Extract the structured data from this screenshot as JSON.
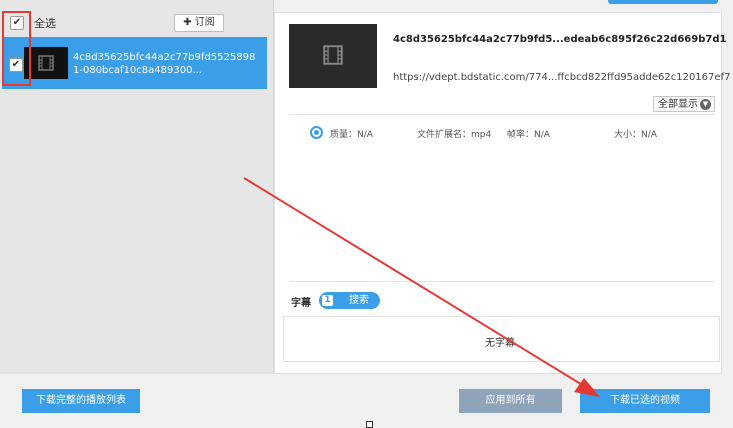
{
  "left_panel": {
    "select_all_label": "全选",
    "subscribe_label": "✚ 订阅",
    "item": {
      "text": "4c8d35625bfc44a2c77b9fd55258981-080bcaf10c8a489300..."
    }
  },
  "detail": {
    "title": "4c8d35625bfc44a2c77b9fd5...edeab6c895f26c22d669b7d1",
    "url": "https://vdept.bdstatic.com/774...ffcbcd822ffd95adde62c120167ef7",
    "show_all_label": "全部显示",
    "meta": {
      "quality": "质量：N/A",
      "ext": "文件扩展名：mp4",
      "framerate": "帧率：N/A",
      "size": "大小：N/A"
    },
    "subtitle_label": "字幕",
    "search_label": "搜索",
    "search_icon_letter": "1",
    "no_subtitle": "无字幕"
  },
  "buttons": {
    "download_playlist": "下载完整的播放列表",
    "apply_all": "应用到所有",
    "download_selected": "下载已选的视频"
  },
  "colors": {
    "accent": "#3a9ee8",
    "annotation": "#e53935",
    "disabled_button": "#8fa3bb"
  },
  "icons": {
    "film": "film-icon",
    "check": "check-icon",
    "chevron": "chevron-down-icon"
  }
}
